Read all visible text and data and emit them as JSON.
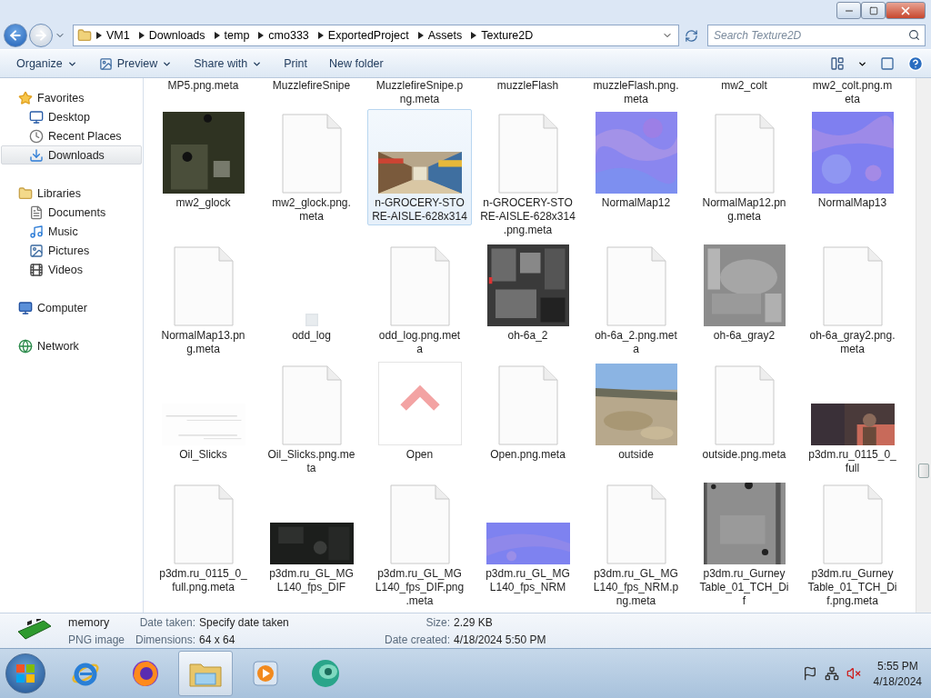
{
  "navigation": {
    "back_enabled": true,
    "forward_enabled": false
  },
  "address": {
    "path": [
      "VM1",
      "Downloads",
      "temp",
      "cmo333",
      "ExportedProject",
      "Assets",
      "Texture2D"
    ],
    "search": {
      "placeholder": "Search Texture2D"
    }
  },
  "toolbar": {
    "items": [
      {
        "label": "Organize",
        "dropdown": true,
        "kind": "plain"
      },
      {
        "label": "Preview",
        "dropdown": true,
        "kind": "preview"
      },
      {
        "label": "Share with",
        "dropdown": true,
        "kind": "plain"
      },
      {
        "label": "Print",
        "dropdown": false,
        "kind": "plain"
      },
      {
        "label": "New folder",
        "dropdown": false,
        "kind": "plain"
      }
    ]
  },
  "sidebar": {
    "groups": [
      {
        "label": "Favorites",
        "kind": "star",
        "children": [
          {
            "label": "Desktop",
            "kind": "desktop",
            "selected": false
          },
          {
            "label": "Recent Places",
            "kind": "recent",
            "selected": false
          },
          {
            "label": "Downloads",
            "kind": "downloads",
            "selected": true
          }
        ]
      },
      {
        "label": "Libraries",
        "kind": "library",
        "children": [
          {
            "label": "Documents",
            "kind": "document",
            "selected": false
          },
          {
            "label": "Music",
            "kind": "music",
            "selected": false
          },
          {
            "label": "Pictures",
            "kind": "pictures",
            "selected": false
          },
          {
            "label": "Videos",
            "kind": "videos",
            "selected": false
          }
        ]
      },
      {
        "label": "Computer",
        "kind": "computer"
      },
      {
        "label": "Network",
        "kind": "network"
      }
    ]
  },
  "partial_row": [
    {
      "lines": [
        "MP5.png.meta"
      ]
    },
    {
      "lines": [
        "MuzzlefireSnipe"
      ]
    },
    {
      "lines": [
        "MuzzlefireSnipe.p",
        "ng.meta"
      ]
    },
    {
      "lines": [
        "muzzleFlash"
      ]
    },
    {
      "lines": [
        "muzzleFlash.png.",
        "meta"
      ]
    },
    {
      "lines": [
        "mw2_colt"
      ]
    },
    {
      "lines": [
        "mw2_colt.png.m",
        "eta"
      ]
    }
  ],
  "files": [
    {
      "lines": [
        "mw2_glock"
      ],
      "kind": "picture",
      "selected": false
    },
    {
      "lines": [
        "mw2_glock.png.",
        "meta"
      ],
      "kind": "file",
      "selected": false
    },
    {
      "lines": [
        "n-GROCERY-STO",
        "RE-AISLE-628x314"
      ],
      "kind": "wide-picture",
      "selected": true
    },
    {
      "lines": [
        "n-GROCERY-STO",
        "RE-AISLE-628x314",
        ".png.meta"
      ],
      "kind": "file",
      "selected": false
    },
    {
      "lines": [
        "NormalMap12"
      ],
      "kind": "picture",
      "selected": false
    },
    {
      "lines": [
        "NormalMap12.pn",
        "g.meta"
      ],
      "kind": "file",
      "selected": false
    },
    {
      "lines": [
        "NormalMap13"
      ],
      "kind": "picture",
      "selected": false
    },
    {
      "lines": [
        "NormalMap13.pn",
        "g.meta"
      ],
      "kind": "file",
      "selected": false
    },
    {
      "lines": [
        "odd_log"
      ],
      "kind": "small-picture",
      "selected": false
    },
    {
      "lines": [
        "odd_log.png.met",
        "a"
      ],
      "kind": "file",
      "selected": false
    },
    {
      "lines": [
        "oh-6a_2"
      ],
      "kind": "picture",
      "selected": false
    },
    {
      "lines": [
        "oh-6a_2.png.met",
        "a"
      ],
      "kind": "file",
      "selected": false
    },
    {
      "lines": [
        "oh-6a_gray2"
      ],
      "kind": "picture",
      "selected": false
    },
    {
      "lines": [
        "oh-6a_gray2.png.",
        "meta"
      ],
      "kind": "file",
      "selected": false
    },
    {
      "lines": [
        "Oil_Slicks"
      ],
      "kind": "wide-picture",
      "selected": false
    },
    {
      "lines": [
        "Oil_Slicks.png.me",
        "ta"
      ],
      "kind": "file",
      "selected": false
    },
    {
      "lines": [
        "Open"
      ],
      "kind": "picture",
      "selected": false
    },
    {
      "lines": [
        "Open.png.meta"
      ],
      "kind": "file",
      "selected": false
    },
    {
      "lines": [
        "outside"
      ],
      "kind": "picture",
      "selected": false
    },
    {
      "lines": [
        "outside.png.meta"
      ],
      "kind": "file",
      "selected": false
    },
    {
      "lines": [
        "p3dm.ru_0115_0_",
        "full"
      ],
      "kind": "wide-picture",
      "selected": false
    },
    {
      "lines": [
        "p3dm.ru_0115_0_",
        "full.png.meta"
      ],
      "kind": "file",
      "selected": false
    },
    {
      "lines": [
        "p3dm.ru_GL_MG",
        "L140_fps_DIF"
      ],
      "kind": "wide-picture",
      "selected": false
    },
    {
      "lines": [
        "p3dm.ru_GL_MG",
        "L140_fps_DIF.png",
        ".meta"
      ],
      "kind": "file",
      "selected": false
    },
    {
      "lines": [
        "p3dm.ru_GL_MG",
        "L140_fps_NRM"
      ],
      "kind": "wide-picture",
      "selected": false
    },
    {
      "lines": [
        "p3dm.ru_GL_MG",
        "L140_fps_NRM.p",
        "ng.meta"
      ],
      "kind": "file",
      "selected": false
    },
    {
      "lines": [
        "p3dm.ru_Gurney",
        "Table_01_TCH_Di",
        "f"
      ],
      "kind": "picture",
      "selected": false
    },
    {
      "lines": [
        "p3dm.ru_Gurney",
        "Table_01_TCH_Di",
        "f.png.meta"
      ],
      "kind": "file",
      "selected": false
    }
  ],
  "details": {
    "name": "memory",
    "type": "PNG image",
    "fields": [
      {
        "label": "Date taken:",
        "value": "Specify date taken"
      },
      {
        "label": "Size:",
        "value": "2.29 KB"
      },
      {
        "label": "Dimensions:",
        "value": "64 x 64"
      },
      {
        "label": "Date created:",
        "value": "4/18/2024 5:50 PM"
      }
    ]
  },
  "taskbar": {
    "apps": [
      {
        "kind": "ie",
        "active": false
      },
      {
        "kind": "firefox",
        "active": false
      },
      {
        "kind": "explorer",
        "active": true
      },
      {
        "kind": "media",
        "active": false
      },
      {
        "kind": "teal",
        "active": false
      }
    ],
    "time": "5:55 PM",
    "date": "4/18/2024"
  }
}
